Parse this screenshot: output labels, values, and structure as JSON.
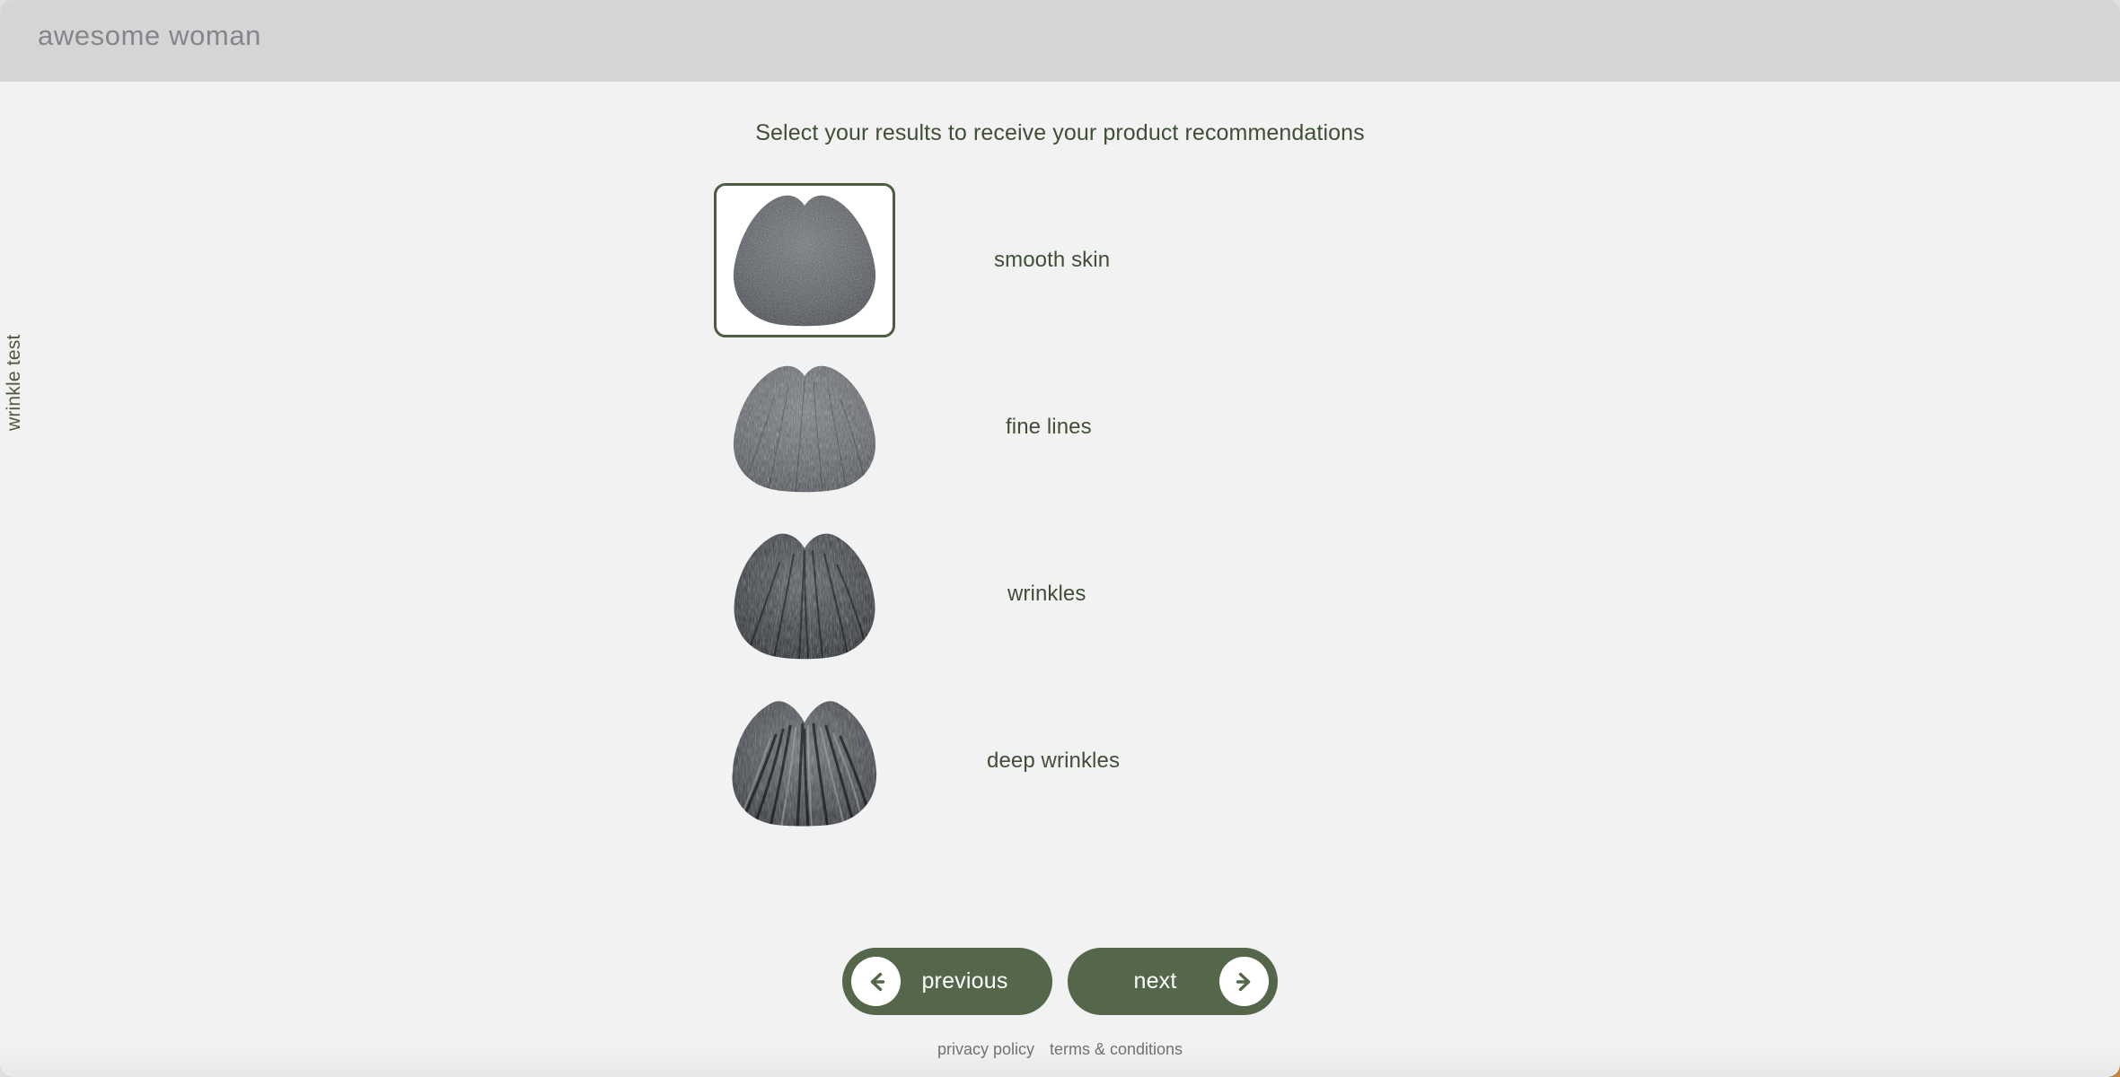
{
  "header": {
    "brand": "awesome woman"
  },
  "side": {
    "test_label": "wrinkle test"
  },
  "main": {
    "prompt": "Select your results to receive your product recommendations",
    "options": [
      {
        "label": "smooth skin",
        "selected": true,
        "thumb_name": "texture-smooth-skin"
      },
      {
        "label": "fine lines",
        "selected": false,
        "thumb_name": "texture-fine-lines"
      },
      {
        "label": "wrinkles",
        "selected": false,
        "thumb_name": "texture-wrinkles"
      },
      {
        "label": "deep wrinkles",
        "selected": false,
        "thumb_name": "texture-deep-wrinkles"
      }
    ]
  },
  "nav": {
    "previous_label": "previous",
    "next_label": "next"
  },
  "footer": {
    "privacy_policy": "privacy policy",
    "terms_conditions": "terms & conditions"
  },
  "colors": {
    "brand_green": "#55674a",
    "text_green": "#3f4f37",
    "selected_border": "#4e5c42",
    "topbar_bg": "#d5d5d5",
    "page_bg": "#f2f2f2",
    "accent_orange": "#cf8b43"
  }
}
